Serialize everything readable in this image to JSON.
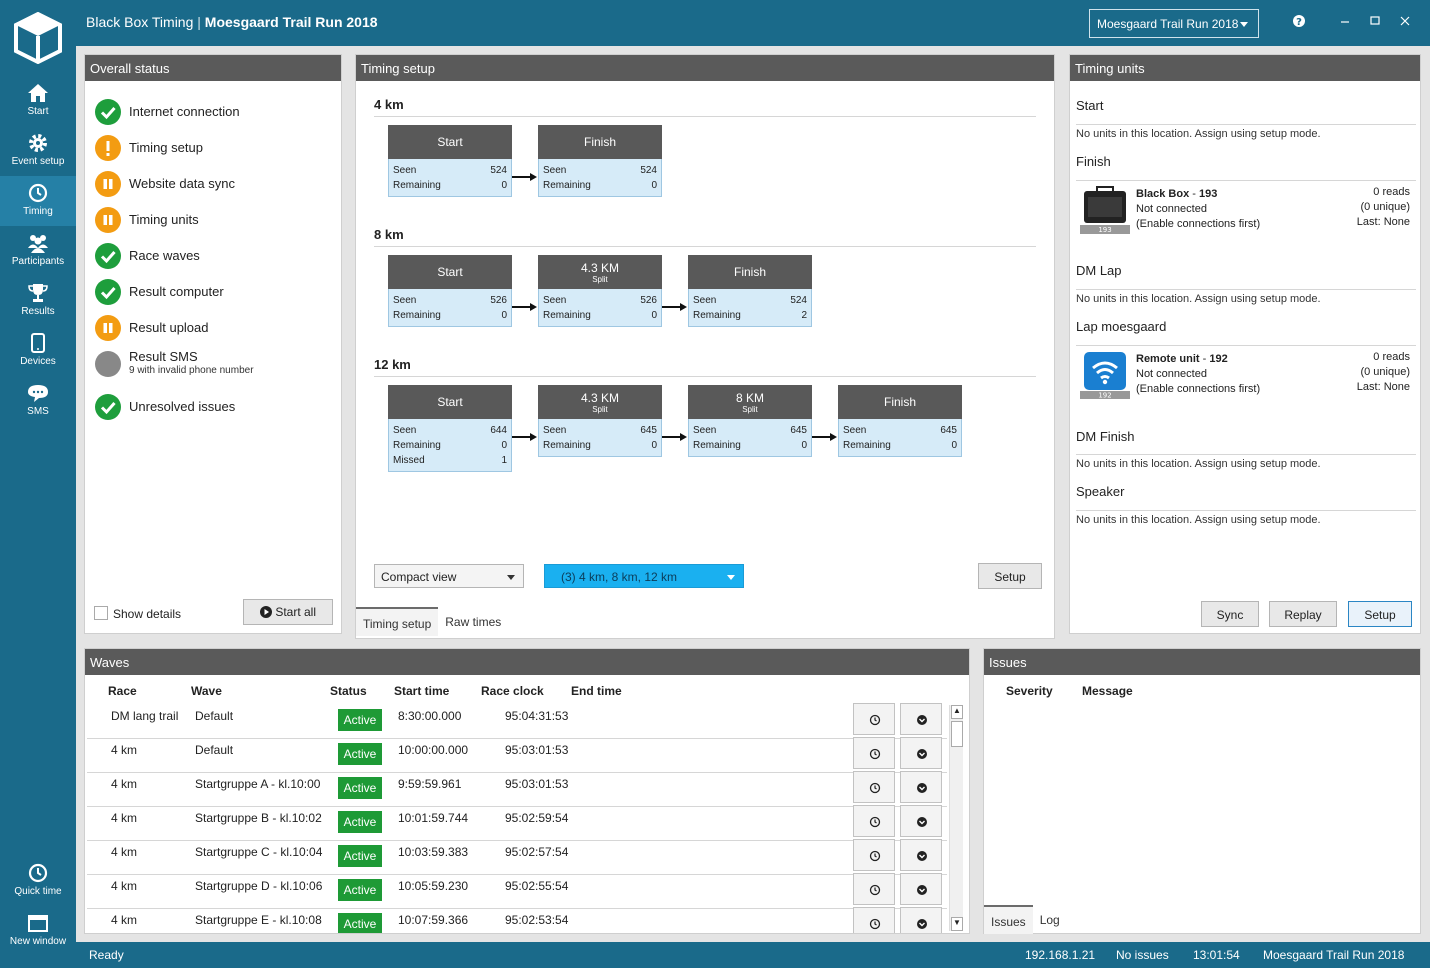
{
  "window": {
    "app_name": "Black Box Timing",
    "separator": "|",
    "event_title": "Moesgaard Trail Run 2018",
    "event_selector": "Moesgaard Trail Run 2018"
  },
  "sidebar": {
    "items": [
      {
        "label": "Start",
        "icon": "home-icon"
      },
      {
        "label": "Event setup",
        "icon": "gear-icon"
      },
      {
        "label": "Timing",
        "icon": "clock-icon"
      },
      {
        "label": "Participants",
        "icon": "people-icon"
      },
      {
        "label": "Results",
        "icon": "trophy-icon"
      },
      {
        "label": "Devices",
        "icon": "tablet-icon"
      },
      {
        "label": "SMS",
        "icon": "chat-icon"
      }
    ],
    "bottom": [
      {
        "label": "Quick time",
        "icon": "clock-icon"
      },
      {
        "label": "New window",
        "icon": "window-icon"
      }
    ]
  },
  "overall_status": {
    "title": "Overall status",
    "items": [
      {
        "label": "Internet connection",
        "state": "ok"
      },
      {
        "label": "Timing setup",
        "state": "warn"
      },
      {
        "label": "Website data sync",
        "state": "paused"
      },
      {
        "label": "Timing units",
        "state": "paused"
      },
      {
        "label": "Race waves",
        "state": "ok"
      },
      {
        "label": "Result computer",
        "state": "ok"
      },
      {
        "label": "Result upload",
        "state": "paused"
      },
      {
        "label": "Result SMS",
        "sub": "9 with invalid phone number",
        "state": "grey"
      },
      {
        "label": "Unresolved issues",
        "state": "ok"
      }
    ],
    "show_details": "Show details",
    "start_all": "Start all"
  },
  "timing_setup": {
    "title": "Timing setup",
    "races": [
      {
        "name": "4 km",
        "points": [
          {
            "name": "Start",
            "rows": [
              {
                "k": "Seen",
                "v": "524"
              },
              {
                "k": "Remaining",
                "v": "0"
              }
            ]
          },
          {
            "name": "Finish",
            "rows": [
              {
                "k": "Seen",
                "v": "524"
              },
              {
                "k": "Remaining",
                "v": "0"
              }
            ]
          }
        ]
      },
      {
        "name": "8 km",
        "points": [
          {
            "name": "Start",
            "rows": [
              {
                "k": "Seen",
                "v": "526"
              },
              {
                "k": "Remaining",
                "v": "0"
              }
            ]
          },
          {
            "name": "4.3 KM",
            "sub": "Split",
            "rows": [
              {
                "k": "Seen",
                "v": "526"
              },
              {
                "k": "Remaining",
                "v": "0"
              }
            ]
          },
          {
            "name": "Finish",
            "rows": [
              {
                "k": "Seen",
                "v": "524"
              },
              {
                "k": "Remaining",
                "v": "2"
              }
            ]
          }
        ]
      },
      {
        "name": "12 km",
        "points": [
          {
            "name": "Start",
            "rows": [
              {
                "k": "Seen",
                "v": "644"
              },
              {
                "k": "Remaining",
                "v": "0"
              },
              {
                "k": "Missed",
                "v": "1"
              }
            ]
          },
          {
            "name": "4.3 KM",
            "sub": "Split",
            "rows": [
              {
                "k": "Seen",
                "v": "645"
              },
              {
                "k": "Remaining",
                "v": "0"
              }
            ]
          },
          {
            "name": "8 KM",
            "sub": "Split",
            "rows": [
              {
                "k": "Seen",
                "v": "645"
              },
              {
                "k": "Remaining",
                "v": "0"
              }
            ]
          },
          {
            "name": "Finish",
            "rows": [
              {
                "k": "Seen",
                "v": "645"
              },
              {
                "k": "Remaining",
                "v": "0"
              }
            ]
          }
        ]
      }
    ],
    "view_select": "Compact view",
    "race_filter": "(3) 4 km, 8 km, 12 km",
    "setup_button": "Setup",
    "tabs": [
      "Timing setup",
      "Raw times"
    ]
  },
  "timing_units": {
    "title": "Timing units",
    "no_units_text": "No units in this location. Assign using setup mode.",
    "locations": [
      "Start",
      "Finish",
      "DM Lap",
      "Lap moesgaard",
      "DM Finish",
      "Speaker"
    ],
    "units": [
      {
        "name": "Black Box",
        "id": "193",
        "status": "Not connected",
        "hint": "(Enable connections first)",
        "reads": "0 reads",
        "unique": "(0 unique)",
        "last": "Last: None",
        "tag": "193"
      },
      {
        "name": "Remote unit",
        "id": "192",
        "status": "Not connected",
        "hint": "(Enable connections first)",
        "reads": "0 reads",
        "unique": "(0 unique)",
        "last": "Last: None",
        "tag": "192"
      }
    ],
    "buttons": {
      "sync": "Sync",
      "replay": "Replay",
      "setup": "Setup"
    }
  },
  "waves": {
    "title": "Waves",
    "columns": [
      "Race",
      "Wave",
      "Status",
      "Start time",
      "Race clock",
      "End time"
    ],
    "rows": [
      {
        "race": "DM lang trail",
        "wave": "Default",
        "status": "Active",
        "start": "8:30:00.000",
        "clock": "95:04:31:53"
      },
      {
        "race": "4 km",
        "wave": "Default",
        "status": "Active",
        "start": "10:00:00.000",
        "clock": "95:03:01:53"
      },
      {
        "race": "4 km",
        "wave": "Startgruppe A - kl.10:00",
        "status": "Active",
        "start": "9:59:59.961",
        "clock": "95:03:01:53"
      },
      {
        "race": "4 km",
        "wave": "Startgruppe B - kl.10:02",
        "status": "Active",
        "start": "10:01:59.744",
        "clock": "95:02:59:54"
      },
      {
        "race": "4 km",
        "wave": "Startgruppe C - kl.10:04",
        "status": "Active",
        "start": "10:03:59.383",
        "clock": "95:02:57:54"
      },
      {
        "race": "4 km",
        "wave": "Startgruppe D - kl.10:06",
        "status": "Active",
        "start": "10:05:59.230",
        "clock": "95:02:55:54"
      },
      {
        "race": "4 km",
        "wave": "Startgruppe E - kl.10:08",
        "status": "Active",
        "start": "10:07:59.366",
        "clock": "95:02:53:54"
      }
    ]
  },
  "issues": {
    "title": "Issues",
    "columns": [
      "Severity",
      "Message"
    ],
    "tabs": [
      "Issues",
      "Log"
    ]
  },
  "statusbar": {
    "left": "Ready",
    "ip": "192.168.1.21",
    "issues": "No issues",
    "time": "13:01:54",
    "event": "Moesgaard Trail Run 2018"
  },
  "colors": {
    "brand": "#1a6a8a",
    "ok": "#1e9e3c",
    "warn": "#f39c12",
    "active_badge": "#1e9a36",
    "panel_header": "#5a5a5a",
    "timing_point_body": "#d6ebf8",
    "race_filter": "#1ab0f0"
  }
}
